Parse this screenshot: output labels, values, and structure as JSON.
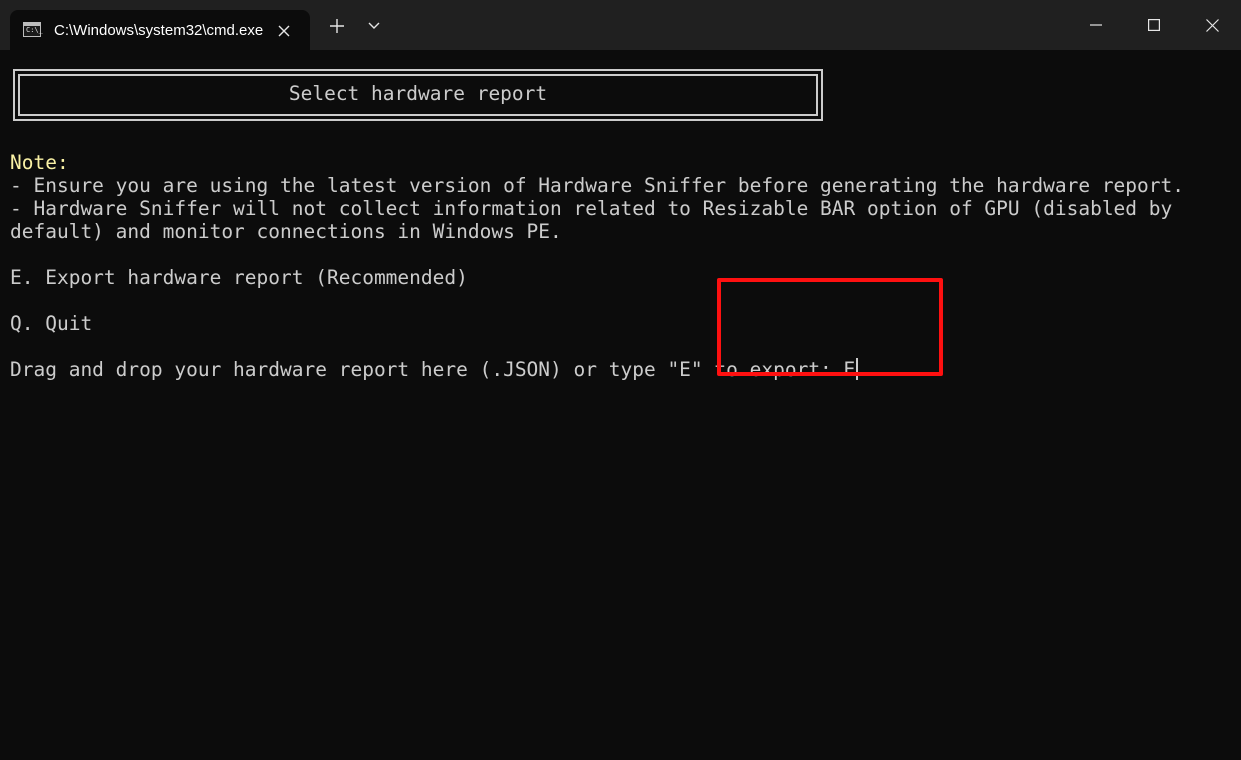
{
  "window": {
    "tab_title": "C:\\Windows\\system32\\cmd.exe",
    "tab_icon": "cmd-icon",
    "new_tab_label": "+",
    "colors": {
      "titlebar_bg": "#202020",
      "terminal_bg": "#0c0c0c",
      "text": "#cccccc",
      "note": "#f9f1a5",
      "highlight": "#ff1010"
    }
  },
  "terminal": {
    "header": "Select hardware report",
    "note_label": "Note:",
    "note_lines": [
      "- Ensure you are using the latest version of Hardware Sniffer before generating the hardware report.",
      "- Hardware Sniffer will not collect information related to Resizable BAR option of GPU (disabled by",
      "default) and monitor connections in Windows PE."
    ],
    "options": [
      "E. Export hardware report (Recommended)",
      "Q. Quit"
    ],
    "prompt": "Drag and drop your hardware report here (.JSON) or type \"E\" to export: ",
    "input_value": "E"
  }
}
